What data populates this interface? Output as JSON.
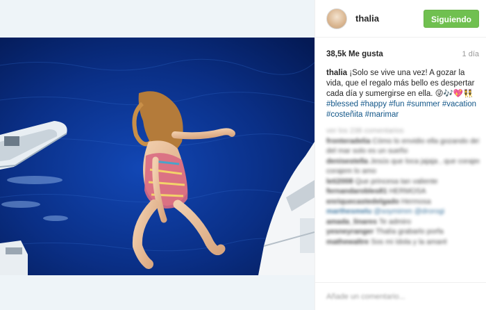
{
  "post": {
    "username": "thalia",
    "follow_label": "Siguiendo",
    "likes": "38,5k Me gusta",
    "time_ago": "1 día",
    "caption_user": "thalia",
    "caption_text": "¡Solo se vive una vez! A gozar la vida, que el regalo más bello es despertar cada día y sumergirse en ella. 😜🎶💖👯",
    "hashtags": "#blessed #happy #fun #summer #vacation #costeñita #marimar",
    "photo_icon": "photo-woman-jumping-into-sea"
  },
  "comments": [
    {
      "user": "",
      "text": "ver los 238 comentarios",
      "style": "muted"
    },
    {
      "user": "fronteradelia",
      "text": "Cómo lo envidio ella gozando del mar que darle tan solo se vi",
      "style": "normal"
    },
    {
      "user": "",
      "text": "del mar solo es un sueño",
      "style": "normal"
    },
    {
      "user": "denisestella",
      "text": "Jesús que loca jajaja , que corajem lo amo",
      "style": "normal"
    },
    {
      "user": "",
      "text": "corajem lo amo",
      "style": "normal"
    },
    {
      "user": "leti2008",
      "text": "Que princesa tan valiente",
      "style": "normal"
    },
    {
      "user": "fernandarobles81",
      "text": "HERMOSA",
      "style": "normal"
    },
    {
      "user": "enriquecastedelgado",
      "text": "Hermosa",
      "style": "normal"
    },
    {
      "user": "marthesmelu",
      "text": "@soymimm @drorogi",
      "style": "link"
    },
    {
      "user": "amada_linares",
      "text": "Te admiro",
      "style": "normal"
    },
    {
      "user": "yesneyranger",
      "text": "Thalía grabarlo porfa",
      "style": "normal"
    },
    {
      "user": "mathewaltre",
      "text": "Sos mi ídola y la amaré",
      "style": "normal"
    }
  ],
  "add_comment_placeholder": "Añade un comentario...",
  "colors": {
    "follow_green": "#70c050",
    "hashtag_blue": "#125688",
    "sea_blue": "#0a2f86"
  }
}
